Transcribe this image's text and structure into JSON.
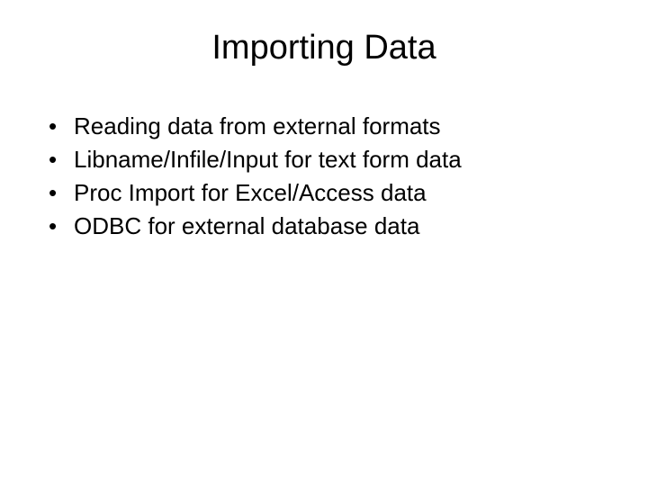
{
  "title": "Importing Data",
  "bullets": [
    "Reading data from external formats",
    "Libname/Infile/Input for text form data",
    "Proc Import for Excel/Access data",
    "ODBC for external database data"
  ]
}
